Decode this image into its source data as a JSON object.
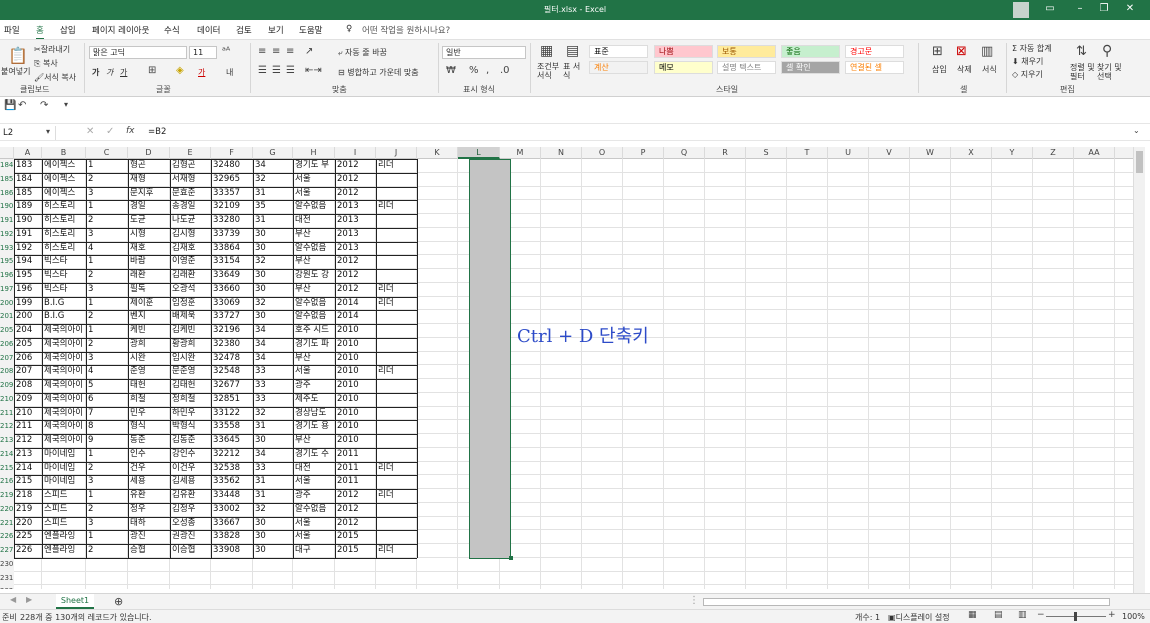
{
  "app": {
    "title": "필터.xlsx  -  Excel"
  },
  "menu": {
    "tabs": [
      "파일",
      "홈",
      "삽입",
      "페이지 레이아웃",
      "수식",
      "데이터",
      "검토",
      "보기",
      "도움말"
    ],
    "search": "어떤 작업을 원하시나요?",
    "share": "공유"
  },
  "ribbon": {
    "clipboard": {
      "paste": "붙여넣기",
      "cut": "잘라내기",
      "copy": "복사",
      "format_painter": "서식 복사",
      "group": "클립보드"
    },
    "font": {
      "name": "맑은 고딕",
      "size": "11",
      "group": "글꼴"
    },
    "alignment": {
      "wrap": "자동 줄 바꿈",
      "merge": "병합하고 가운데 맞춤",
      "group": "맞춤"
    },
    "number": {
      "format": "일반",
      "group": "표시 형식"
    },
    "styles": {
      "cond_format": "조건부 서식",
      "table_format": "표 서식",
      "group": "스타일",
      "cells": [
        {
          "label": "표준",
          "bg": "#ffffff",
          "color": "#000000"
        },
        {
          "label": "나쁨",
          "bg": "#ffc7ce",
          "color": "#9c0006"
        },
        {
          "label": "보통",
          "bg": "#ffeb9c",
          "color": "#9c5700"
        },
        {
          "label": "좋음",
          "bg": "#c6efce",
          "color": "#006100"
        },
        {
          "label": "경고문",
          "bg": "#ffffff",
          "color": "#ff0000"
        },
        {
          "label": "계산",
          "bg": "#f2f2f2",
          "color": "#fa7d00"
        },
        {
          "label": "메모",
          "bg": "#ffffcc",
          "color": "#000000"
        },
        {
          "label": "설명 텍스트",
          "bg": "#ffffff",
          "color": "#7f7f7f"
        },
        {
          "label": "셀 확인",
          "bg": "#a5a5a5",
          "color": "#ffffff"
        },
        {
          "label": "연결된 셀",
          "bg": "#ffffff",
          "color": "#fa7d00"
        }
      ]
    },
    "cells": {
      "insert": "삽입",
      "delete": "삭제",
      "format": "서식",
      "group": "셀"
    },
    "editing": {
      "autosum": "자동 합계",
      "fill": "채우기",
      "clear": "지우기",
      "sort": "정렬 및 필터",
      "find": "찾기 및 선택",
      "group": "편집"
    }
  },
  "formula_bar": {
    "name_box": "L2",
    "fx": "fx",
    "formula": "=B2"
  },
  "columns": [
    "A",
    "B",
    "C",
    "D",
    "E",
    "F",
    "G",
    "H",
    "I",
    "J",
    "K",
    "L",
    "M",
    "N",
    "O",
    "P",
    "Q",
    "R",
    "S",
    "T",
    "U",
    "V",
    "W",
    "X",
    "Y",
    "Z",
    "AA"
  ],
  "selected_column": "L",
  "rows": [
    {
      "n": "184",
      "c": [
        "183",
        "에이젝스",
        "1",
        "형곤",
        "김형곤",
        "32480",
        "34",
        "경기도 부",
        "2012",
        "리더"
      ]
    },
    {
      "n": "185",
      "c": [
        "184",
        "에이젝스",
        "2",
        "재형",
        "서재형",
        "32965",
        "32",
        "서울",
        "2012",
        ""
      ]
    },
    {
      "n": "186",
      "c": [
        "185",
        "에이젝스",
        "3",
        "문지후",
        "문효준",
        "33357",
        "31",
        "서울",
        "2012",
        ""
      ]
    },
    {
      "n": "190",
      "c": [
        "189",
        "히스토리",
        "1",
        "경일",
        "송경일",
        "32109",
        "35",
        "알수없음",
        "2013",
        "리더"
      ]
    },
    {
      "n": "191",
      "c": [
        "190",
        "히스토리",
        "2",
        "도균",
        "나도균",
        "33280",
        "31",
        "대전",
        "2013",
        ""
      ]
    },
    {
      "n": "192",
      "c": [
        "191",
        "히스토리",
        "3",
        "시형",
        "김시형",
        "33739",
        "30",
        "부산",
        "2013",
        ""
      ]
    },
    {
      "n": "193",
      "c": [
        "192",
        "히스토리",
        "4",
        "재호",
        "김재호",
        "33864",
        "30",
        "알수없음",
        "2013",
        ""
      ]
    },
    {
      "n": "195",
      "c": [
        "194",
        "빅스타",
        "1",
        "바람",
        "이영준",
        "33154",
        "32",
        "부산",
        "2012",
        ""
      ]
    },
    {
      "n": "196",
      "c": [
        "195",
        "빅스타",
        "2",
        "래환",
        "김래환",
        "33649",
        "30",
        "강원도 강",
        "2012",
        ""
      ]
    },
    {
      "n": "197",
      "c": [
        "196",
        "빅스타",
        "3",
        "필독",
        "오광석",
        "33660",
        "30",
        "부산",
        "2012",
        "리더"
      ]
    },
    {
      "n": "200",
      "c": [
        "199",
        "B.I.G",
        "1",
        "제이훈",
        "임정훈",
        "33069",
        "32",
        "알수없음",
        "2014",
        "리더"
      ]
    },
    {
      "n": "201",
      "c": [
        "200",
        "B.I.G",
        "2",
        "벤지",
        "배제욱",
        "33727",
        "30",
        "알수없음",
        "2014",
        ""
      ]
    },
    {
      "n": "205",
      "c": [
        "204",
        "제국의아이",
        "1",
        "케빈",
        "김케빈",
        "32196",
        "34",
        "호주 시드",
        "2010",
        ""
      ]
    },
    {
      "n": "206",
      "c": [
        "205",
        "제국의아이",
        "2",
        "광희",
        "황광희",
        "32380",
        "34",
        "경기도 파",
        "2010",
        ""
      ]
    },
    {
      "n": "207",
      "c": [
        "206",
        "제국의아이",
        "3",
        "시완",
        "임시완",
        "32478",
        "34",
        "부산",
        "2010",
        ""
      ]
    },
    {
      "n": "208",
      "c": [
        "207",
        "제국의아이",
        "4",
        "준영",
        "문준영",
        "32548",
        "33",
        "서울",
        "2010",
        "리더"
      ]
    },
    {
      "n": "209",
      "c": [
        "208",
        "제국의아이",
        "5",
        "태헌",
        "김태헌",
        "32677",
        "33",
        "광주",
        "2010",
        ""
      ]
    },
    {
      "n": "210",
      "c": [
        "209",
        "제국의아이",
        "6",
        "희철",
        "정희철",
        "32851",
        "33",
        "제주도",
        "2010",
        ""
      ]
    },
    {
      "n": "211",
      "c": [
        "210",
        "제국의아이",
        "7",
        "민우",
        "하민우",
        "33122",
        "32",
        "경상남도",
        "2010",
        ""
      ]
    },
    {
      "n": "212",
      "c": [
        "211",
        "제국의아이",
        "8",
        "형식",
        "박형식",
        "33558",
        "31",
        "경기도 용",
        "2010",
        ""
      ]
    },
    {
      "n": "213",
      "c": [
        "212",
        "제국의아이",
        "9",
        "동준",
        "김동준",
        "33645",
        "30",
        "부산",
        "2010",
        ""
      ]
    },
    {
      "n": "214",
      "c": [
        "213",
        "마이네임",
        "1",
        "인수",
        "강인수",
        "32212",
        "34",
        "경기도 수",
        "2011",
        ""
      ]
    },
    {
      "n": "215",
      "c": [
        "214",
        "마이네임",
        "2",
        "건우",
        "이건우",
        "32538",
        "33",
        "대전",
        "2011",
        "리더"
      ]
    },
    {
      "n": "216",
      "c": [
        "215",
        "마이네임",
        "3",
        "세용",
        "김세용",
        "33562",
        "31",
        "서울",
        "2011",
        ""
      ]
    },
    {
      "n": "219",
      "c": [
        "218",
        "스피드",
        "1",
        "유환",
        "김유환",
        "33448",
        "31",
        "광주",
        "2012",
        "리더"
      ]
    },
    {
      "n": "220",
      "c": [
        "219",
        "스피드",
        "2",
        "정우",
        "김정우",
        "33002",
        "32",
        "알수없음",
        "2012",
        ""
      ]
    },
    {
      "n": "221",
      "c": [
        "220",
        "스피드",
        "3",
        "태하",
        "오성종",
        "33667",
        "30",
        "서울",
        "2012",
        ""
      ]
    },
    {
      "n": "226",
      "c": [
        "225",
        "엔플라잉",
        "1",
        "광진",
        "권광진",
        "33828",
        "30",
        "서울",
        "2015",
        ""
      ]
    },
    {
      "n": "227",
      "c": [
        "226",
        "엔플라잉",
        "2",
        "승협",
        "이승협",
        "33908",
        "30",
        "대구",
        "2015",
        "리더"
      ]
    },
    {
      "n": "230",
      "c": []
    },
    {
      "n": "231",
      "c": []
    },
    {
      "n": "232",
      "c": []
    }
  ],
  "annotation": "Ctrl + D 단축키",
  "sheet": {
    "tab": "Sheet1"
  },
  "status": {
    "mode": "준비",
    "message": "228개 중 130개의 레코드가 있습니다.",
    "count": "개수: 1",
    "display": "디스플레이 설정",
    "zoom": "100%"
  }
}
